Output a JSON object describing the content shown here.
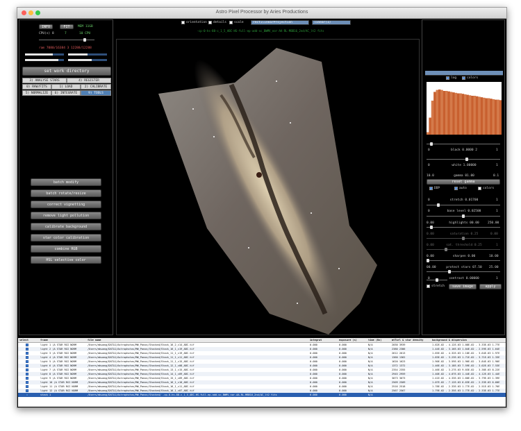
{
  "window": {
    "title": "Astro Pixel Processor by  Aries Productions"
  },
  "top_left": {
    "btn_info": "INFO",
    "btn_fit": "FIT",
    "mem_label": "MEM 11GB",
    "cpu_label": "CPU(s) 8",
    "threads_label": "7",
    "threads2_label": "10 CPU",
    "ram_label": "ram 7080/16384  3 12288/12288",
    "progress1": 0.72,
    "progress2": 0.5,
    "progress3": 0.85,
    "progress4": 0.6,
    "set_work_dir": "set work directory"
  },
  "tabs": {
    "row1": [
      "3) ANALYSE STARS",
      "4) REGISTER"
    ],
    "row2": [
      "0) RAW/FITS",
      "1) LOAD",
      "2) CALIBRATE"
    ],
    "row3": [
      "5) NORMALIZE",
      "6) INTEGRATE",
      "9) TOOLS"
    ]
  },
  "tools": [
    "batch modify",
    "batch rotate/resize",
    "correct vignetting",
    "remove light pollution",
    "calibrate background",
    "star color calibration",
    "combine RGB",
    "HSL selective color"
  ],
  "header": {
    "orientation": "orientation",
    "details": "details",
    "scale": "scale",
    "projection": "rectilinearProjection",
    "stretch_mode": "linear(1)",
    "filename": "-cp-0-hs-88-c_1_5_ABC-HS-full-ep-add-sc_BWMV_nor-AA-RL-MBB16_2nd/AC_lt2 fits"
  },
  "right_panel": {
    "log": "log",
    "colors": "colors",
    "black": "black 0.0000 2",
    "black_min": "0",
    "black_max": "1",
    "white": "white 1.00000",
    "white_min": "0",
    "white_max": "1",
    "gamma": "gamma 01.00",
    "gamma_min": "10.0",
    "gamma_max": "0.1",
    "reset_gamma": "reset gamma",
    "ddp": "DDP",
    "auto": "auto",
    "colors2": "colors",
    "stretch": "stretch 0.01700",
    "stretch_min": "0",
    "stretch_max": "1",
    "base_level": "base level 0.02500",
    "base_min": "0",
    "base_max": "1",
    "highlights": "highlights 00.00",
    "highlights_min": "0.00",
    "highlights_max": "250.00",
    "saturation": "saturation 0.25",
    "saturation_min": "0.00",
    "saturation_max": "0.00",
    "sat_threshold": "sat. threshold 0.25",
    "sat_threshold_min": "0.00",
    "sat_threshold_max": "1",
    "sharpen": "sharpen 0.00",
    "sharpen_min": "0.00",
    "sharpen_max": "10.00",
    "protect_stars": "protect stars 07.50",
    "protect_min": "00.00",
    "protect_max": "25.00",
    "contrast": "contrast 0.00000",
    "contrast_min": "0",
    "contrast_max": "1",
    "stretch_chk": "stretch",
    "save_image": "save image",
    "apply": "apply",
    "black_val": 0.05,
    "white_val": 0.55,
    "gamma_val": 0.5,
    "stretch_val": 0.15,
    "base_val": 0.5,
    "highlights_val": 0.05,
    "saturation_val": 0.5,
    "sat_threshold_val": 0.25,
    "sharpen_val": 0.0,
    "protect_val": 0.3,
    "contrast_val": 0.5
  },
  "histogram": {
    "bins": [
      0.05,
      0.35,
      0.7,
      0.88,
      0.92,
      0.93,
      0.92,
      0.9,
      0.9,
      0.89,
      0.88,
      0.87,
      0.86,
      0.85,
      0.85,
      0.84,
      0.83,
      0.82,
      0.81,
      0.8,
      0.8,
      0.79,
      0.78,
      0.77,
      0.76,
      0.75,
      0.75,
      0.74,
      0.73,
      0.72,
      0.72,
      0.71
    ]
  },
  "table": {
    "columns": [
      "select",
      "frame",
      "file name",
      "integrat",
      "exposure (s)",
      "time (Hz)",
      "mtTurl & star density",
      "background & dispersion"
    ],
    "rows": [
      [
        "light 1 (A STAR RGI NORM",
        "/Users/mkwang/DATA1/Astrophotos/MW_Panos/Stacked/Stack_16_2_c14_ABC.tif",
        "0.000",
        "0.000",
        "N/A",
        "2030 3939",
        "1.62E-02 - 4.12E-03  1.08E-02 - 3.33E-03  1.77E"
      ],
      [
        "light 2 (A STAR RGI NORM",
        "/Users/mkwang/DATA1/Astrophotos/MW_Panos/Stacked/Stack_16_1_c19_ABC.tif",
        "0.000",
        "0.000",
        "N/A",
        "2380 2386",
        "1.44E-02 - 3.16E-03  1.04E-02 - 2.59E-03  1.64E"
      ],
      [
        "light 3 (A STAR RGI NORM",
        "/Users/mkwang/DATA1/Astrophotos/MW_Panos/Stacked/Stack_11_1_c19_ABC.tif",
        "0.000",
        "0.000",
        "N/A",
        "2612 2613",
        "1.65E-02 - 4.32E-03  1.18E-02 - 3.64E-03  1.97E"
      ],
      [
        "light 4 (A STAR RGI NORM",
        "/Users/mkwang/DATA1/Astrophotos/MW_Panos/Stacked/Stack_11_1_c11_ABC.tif",
        "0.000",
        "0.000",
        "N/A",
        "1360 1362",
        "1.83E-02 - 3.23E-03  1.71E-02 - 3.71E-03  1.33E"
      ],
      [
        "light 5 (A STAR RGI NORM",
        "/Users/mkwang/DATA1/Astrophotos/MW_Panos/Stacked/Stack_11_1_c15_ABC.tif",
        "0.000",
        "0.000",
        "N/A",
        "1620 1623",
        "1.90E-02 - 3.59E-03  1.96E-02 - 3.84E-03  1.90E"
      ],
      [
        "light 6 (A STAR RGI NORM",
        "/Users/mkwang/DATA1/Astrophotos/MW_Panos/Stacked/Stack_12_1_c08_ABC.tif",
        "0.000",
        "0.000",
        "N/A",
        "1372 1372",
        "1.46E-02 - 3.18E-03  7.59E-02 - 3.02E-03  7.53E"
      ],
      [
        "light 7 (A STAR RGI NORM",
        "/Users/mkwang/DATA1/Astrophotos/MW_Panos/Stacked/Stack_13_1_c15_ABC.tif",
        "0.000",
        "0.000",
        "N/A",
        "2354 2355",
        "1.46E-02 - 3.27E-03  9.03E-02 - 3.38E-03  8.22E"
      ],
      [
        "light 8 (A STAR RGI NORM",
        "/Users/mkwang/DATA1/Astrophotos/MW_Panos/Stacked/Stack_14_1_c09_ABC.tif",
        "0.000",
        "0.000",
        "N/A",
        "2945 2959",
        "1.40E-02 - 4.07E-03  1.44E-02 - 4.12E-03  1.44E"
      ],
      [
        "light 9 (A STAR RGI NORM",
        "/Users/mkwang/DATA1/Astrophotos/MW_Panos/Stacked/Stack_15_1_c09_ABC.tif",
        "0.000",
        "0.000",
        "N/A",
        "3073 3073",
        "1.41E-02 - 4.33E-03  1.60E-02 - 3.79E-03  1.39E"
      ],
      [
        "light 10 (A STAR RGI NORM",
        "/Users/mkwang/DATA1/Astrophotos/MW_Panos/Stacked/Stack_16_1_c10_ABC.tif",
        "0.000",
        "0.000",
        "N/A",
        "2509 2509",
        "1.07E-02 - 7.12E-03  6.63E-02 - 2.33E-03  6.60E"
      ],
      [
        "light 11 (A STAR RGI NORM",
        "/Users/mkwang/DATA1/Astrophotos/MW_Panos/Stacked/Stack_16_1_c11_ABC.tif",
        "0.000",
        "0.000",
        "N/A",
        "2516 2518",
        "1.78E-02 - 2.33E-03  1.77E-02 - 2.51E-03  1.76E"
      ],
      [
        "light 12 (A STAR RGI NORM",
        "/Users/mkwang/DATA1/Astrophotos/MW_Panos/Stacked/Stack_16_1_c07_ABC.tif",
        "0.000",
        "0.000",
        "N/A",
        "2567 2567",
        "1.79E-02 - 2.35E-03  1.77E-02 - 2.33E-03  1.77E"
      ],
      [
        "stack 1",
        "/Users/mkwang/DATA1/Astrophotos/MW_Panos/Stacked/ -cp-0-hs-88-c_1_5_ABC-HS-full-ep-add-sc_BWMV_nor-AA-RL-MBB16_2nd/AC_lt2 fits",
        "0.000",
        "0.000",
        "N/A",
        "",
        ""
      ]
    ]
  }
}
